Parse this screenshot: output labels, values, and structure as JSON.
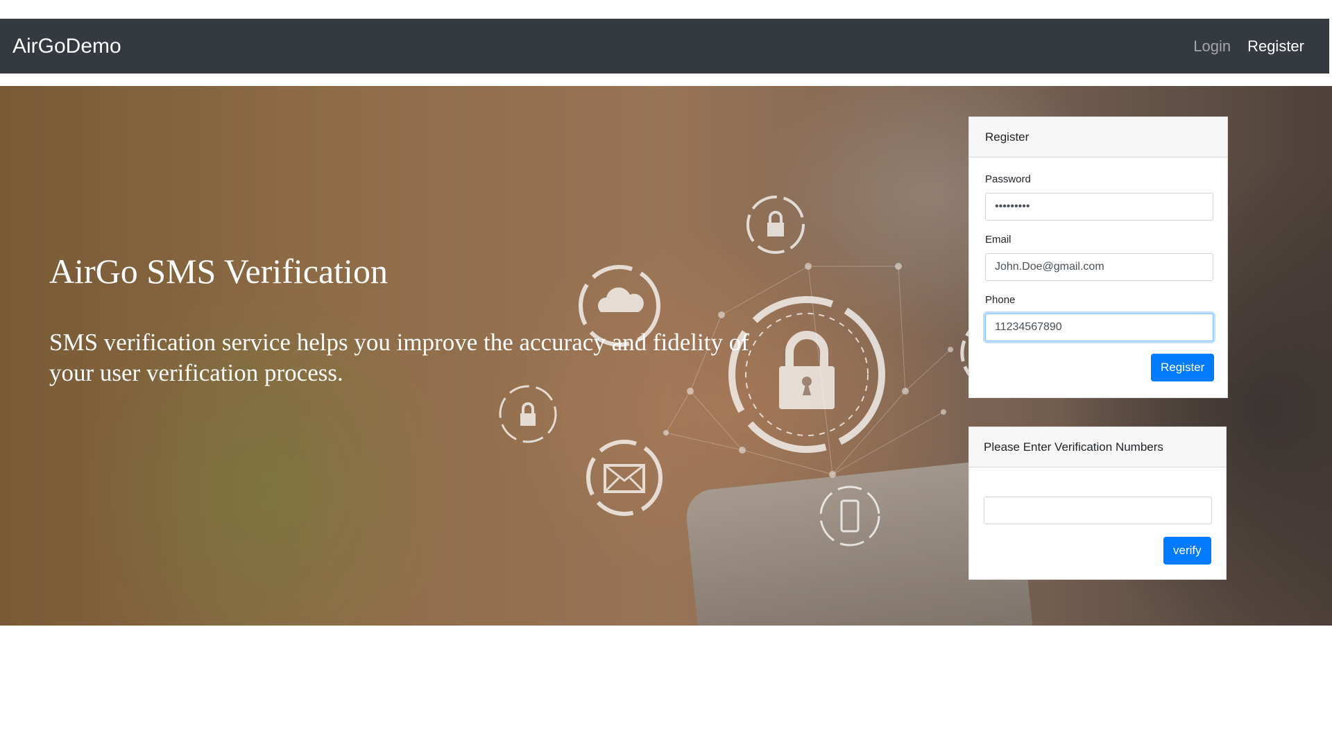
{
  "navbar": {
    "brand": "AirGoDemo",
    "links": [
      {
        "label": "Login"
      },
      {
        "label": "Register"
      }
    ]
  },
  "hero": {
    "title": "AirGo SMS Verification",
    "description": "SMS verification service helps you improve the accuracy and fidelity of your user verification process."
  },
  "register_card": {
    "header": "Register",
    "password_label": "Password",
    "password_value": "•••••••••",
    "email_label": "Email",
    "email_value": "John.Doe@gmail.com",
    "phone_label": "Phone",
    "phone_value": "11234567890",
    "submit_label": "Register"
  },
  "verify_card": {
    "header": "Please Enter Verification Numbers",
    "code_value": "",
    "submit_label": "verify"
  },
  "icons": [
    "lock-icon",
    "cloud-icon",
    "padlock-icon",
    "envelope-icon",
    "smartphone-icon",
    "wifi-icon"
  ],
  "colors": {
    "navbar": "#343a40",
    "primary": "#007bff"
  }
}
